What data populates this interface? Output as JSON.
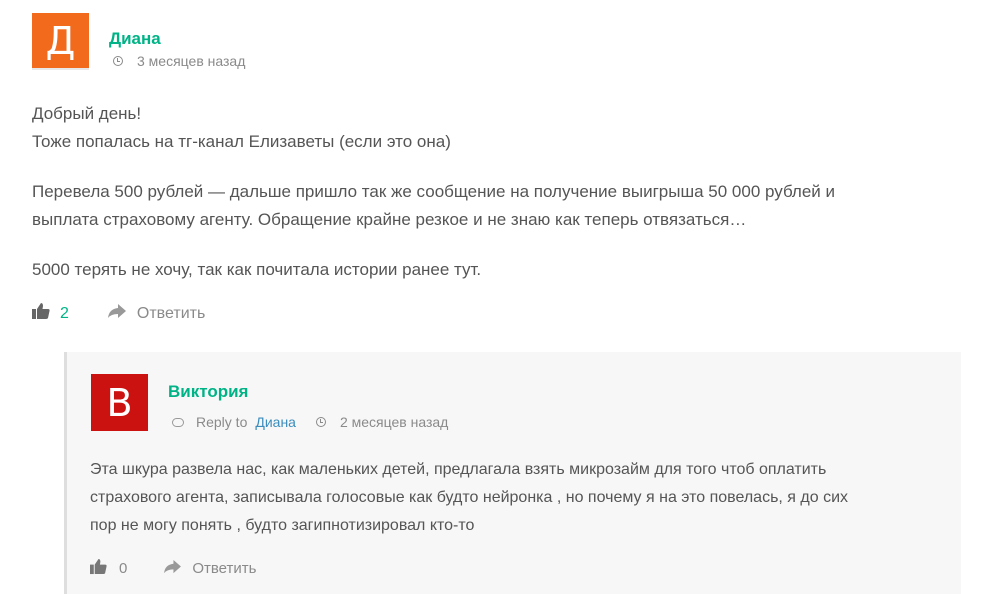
{
  "comment": {
    "avatar_letter": "Д",
    "author": "Диана",
    "time": "3 месяцев назад",
    "paragraphs": [
      "Добрый день!",
      "Тоже попалась на тг-канал Елизаветы (если это она)",
      "Перевела 500 рублей — дальше пришло так же сообщение на получение выигрыша 50 000 рублей и",
      "выплата страховому агенту. Обращение крайне резкое и не знаю как теперь отвязаться…",
      "5000 терять не хочу, так как почитала истории ранее тут."
    ],
    "likes": "2",
    "reply_label": "Ответить",
    "avatar_color": "#f26b1d"
  },
  "reply": {
    "avatar_letter": "В",
    "author": "Виктория",
    "reply_to_prefix": "Reply to",
    "reply_to_name": "Диана",
    "time": "2 месяцев назад",
    "lines": [
      "Эта шкура развела нас, как маленьких детей, предлагала взять микрозайм для того чтоб оплатить",
      "страхового агента, записывала голосовые как будто нейронка , но почему я на это повелась, я до сих",
      "пор не могу понять , будто загипнотизировал кто-то"
    ],
    "likes": "0",
    "reply_label": "Ответить",
    "avatar_color": "#cc1111"
  },
  "icons": {
    "like": "thumbs-up-icon",
    "reply": "reply-arrow-icon",
    "time": "clock-icon",
    "reply_to": "chat-bubble-icon"
  },
  "accent_color": "#00b386"
}
